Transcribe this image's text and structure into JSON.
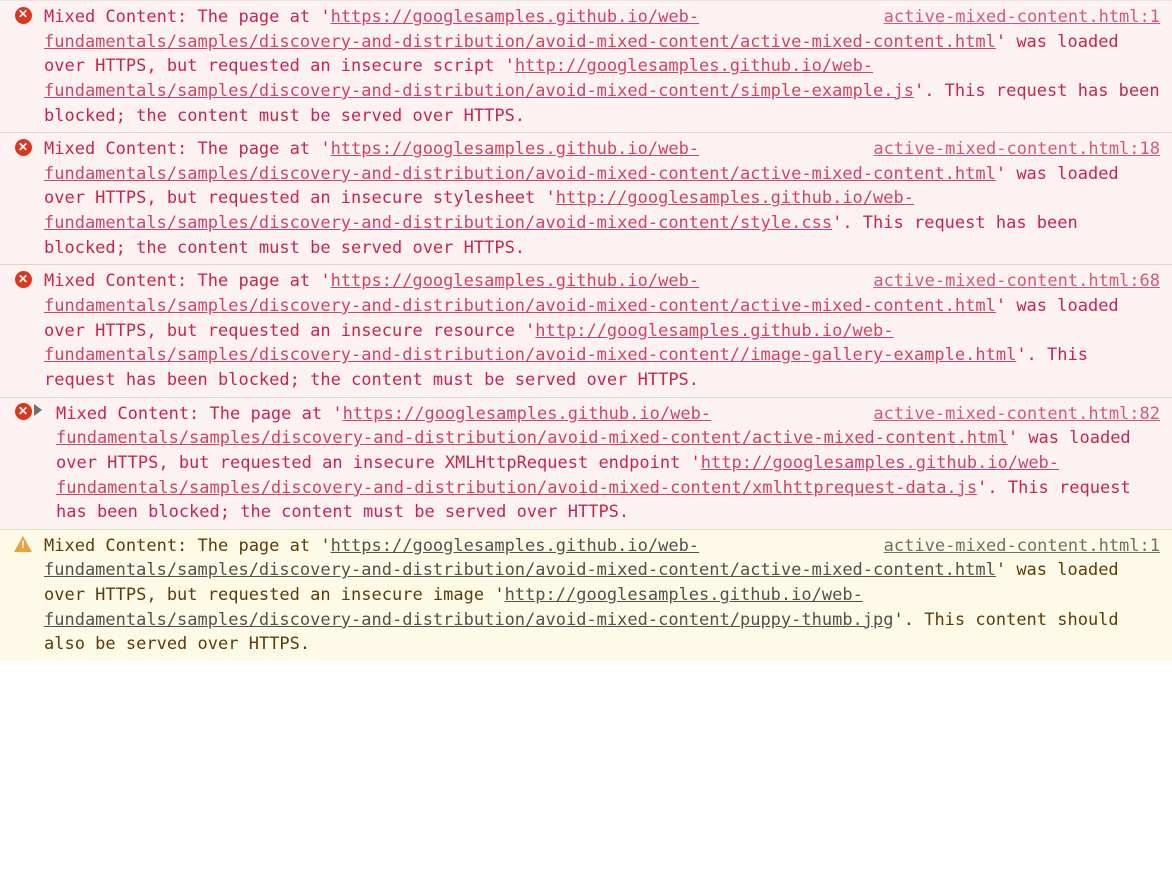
{
  "messages": [
    {
      "level": "error",
      "expandable": false,
      "source": "active-mixed-content.html:1",
      "prefix": "Mixed Content: The page at '",
      "page_url": "https://googlesamples.github.io/web-fundamentals/samples/discovery-and-distribution/avoid-mixed-content/active-mixed-content.html",
      "mid1": "' was loaded over HTTPS, but requested an insecure script '",
      "res_url": "http://googlesamples.github.io/web-fundamentals/samples/discovery-and-distribution/avoid-mixed-content/simple-example.js",
      "suffix": "'. This request has been blocked; the content must be served over HTTPS."
    },
    {
      "level": "error",
      "expandable": false,
      "source": "active-mixed-content.html:18",
      "prefix": "Mixed Content: The page at '",
      "page_url": "https://googlesamples.github.io/web-fundamentals/samples/discovery-and-distribution/avoid-mixed-content/active-mixed-content.html",
      "mid1": "' was loaded over HTTPS, but requested an insecure stylesheet '",
      "res_url": "http://googlesamples.github.io/web-fundamentals/samples/discovery-and-distribution/avoid-mixed-content/style.css",
      "suffix": "'. This request has been blocked; the content must be served over HTTPS."
    },
    {
      "level": "error",
      "expandable": false,
      "source": "active-mixed-content.html:68",
      "prefix": "Mixed Content: The page at '",
      "page_url": "https://googlesamples.github.io/web-fundamentals/samples/discovery-and-distribution/avoid-mixed-content/active-mixed-content.html",
      "mid1": "' was loaded over HTTPS, but requested an insecure resource '",
      "res_url": "http://googlesamples.github.io/web-fundamentals/samples/discovery-and-distribution/avoid-mixed-content//image-gallery-example.html",
      "suffix": "'. This request has been blocked; the content must be served over HTTPS."
    },
    {
      "level": "error",
      "expandable": true,
      "source": "active-mixed-content.html:82",
      "prefix": "Mixed Content: The page at '",
      "page_url": "https://googlesamples.github.io/web-fundamentals/samples/discovery-and-distribution/avoid-mixed-content/active-mixed-content.html",
      "mid1": "' was loaded over HTTPS, but requested an insecure XMLHttpRequest endpoint '",
      "res_url": "http://googlesamples.github.io/web-fundamentals/samples/discovery-and-distribution/avoid-mixed-content/xmlhttprequest-data.js",
      "suffix": "'. This request has been blocked; the content must be served over HTTPS."
    },
    {
      "level": "warning",
      "expandable": false,
      "source": "active-mixed-content.html:1",
      "prefix": "Mixed Content: The page at '",
      "page_url": "https://googlesamples.github.io/web-fundamentals/samples/discovery-and-distribution/avoid-mixed-content/active-mixed-content.html",
      "mid1": "' was loaded over HTTPS, but requested an insecure image '",
      "res_url": "http://googlesamples.github.io/web-fundamentals/samples/discovery-and-distribution/avoid-mixed-content/puppy-thumb.jpg",
      "suffix": "'. This content should also be served over HTTPS."
    }
  ]
}
